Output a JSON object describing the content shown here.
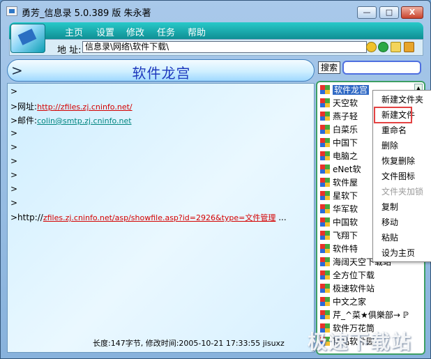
{
  "window": {
    "title": "勇芳_信息录    5.0.389 版  朱永著",
    "controls": {
      "minimize": "—",
      "maximize": "□",
      "close": "X"
    }
  },
  "menu": [
    {
      "label": "主页"
    },
    {
      "label": "设置"
    },
    {
      "label": "修改"
    },
    {
      "label": "任务"
    },
    {
      "label": "帮助"
    }
  ],
  "address": {
    "label": "地 址:",
    "value": "信息录\\网络\\软件下载\\"
  },
  "header": {
    "chevron": ">",
    "title": "软件龙宫"
  },
  "search": {
    "button": "搜索",
    "value": ""
  },
  "content": {
    "lines": [
      {
        "prefix": ">",
        "link": ""
      },
      {
        "prefix": ">网址:",
        "link": "http://zfiles.zj.cninfo.net/"
      },
      {
        "prefix": ">邮件:",
        "link": "colin@smtp.zj.cninfo.net"
      },
      {
        "prefix": ">",
        "link": ""
      },
      {
        "prefix": ">",
        "link": ""
      },
      {
        "prefix": ">",
        "link": ""
      },
      {
        "prefix": ">",
        "link": ""
      },
      {
        "prefix": ">",
        "link": ""
      },
      {
        "prefix": ">",
        "link": ""
      },
      {
        "prefix": ">http://",
        "link": "zfiles.zj.cninfo.net/asp/showfile.asp?id=2926&type=文件管理",
        "suffix": " ..."
      }
    ],
    "status": "长度:147字节, 修改时间:2005-10-21 17:33:55 jisuxz"
  },
  "tree": [
    {
      "label": "软件龙宫",
      "selected": true
    },
    {
      "label": "天空软"
    },
    {
      "label": "燕子轻"
    },
    {
      "label": "白菜乐"
    },
    {
      "label": "中国下"
    },
    {
      "label": "电脑之"
    },
    {
      "label": "eNet软"
    },
    {
      "label": "软件屋"
    },
    {
      "label": "星软下"
    },
    {
      "label": "华军软"
    },
    {
      "label": "中国软"
    },
    {
      "label": "飞翔下"
    },
    {
      "label": "软件特"
    },
    {
      "label": "海阔天空下载站"
    },
    {
      "label": "全方位下载"
    },
    {
      "label": "极速软件站"
    },
    {
      "label": "中文之家"
    },
    {
      "label": "芹_^菜★俱樂部→ ℙ"
    },
    {
      "label": "软件万花筒"
    },
    {
      "label": "精品软件园"
    }
  ],
  "context_menu": [
    {
      "label": "新建文件夹"
    },
    {
      "label": "新建文件"
    },
    {
      "label": "重命名"
    },
    {
      "label": "删除"
    },
    {
      "label": "恢复删除"
    },
    {
      "label": "文件图标"
    },
    {
      "label": "文件夹加锁",
      "disabled": true
    },
    {
      "label": "复制"
    },
    {
      "label": "移动"
    },
    {
      "label": "粘贴"
    },
    {
      "label": "设为主页"
    }
  ],
  "watermark": "极速下载站"
}
